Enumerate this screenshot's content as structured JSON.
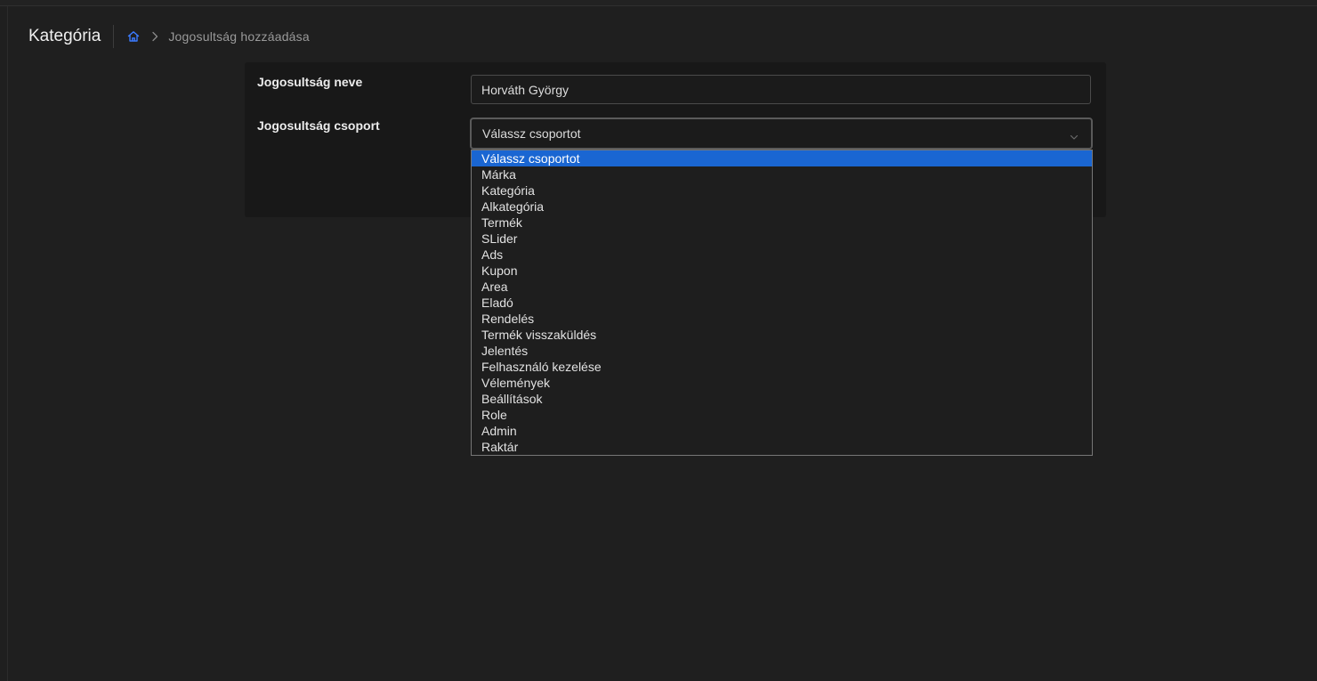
{
  "header": {
    "title": "Kategória",
    "breadcrumb_current": "Jogosultság hozzáadása"
  },
  "form": {
    "name_label": "Jogosultság neve",
    "name_value": "Horváth György",
    "group_label": "Jogosultság csoport",
    "group_selected": "Válassz csoportot"
  },
  "dropdown": {
    "options": [
      "Válassz csoportot",
      "Márka",
      "Kategória",
      "Alkategória",
      "Termék",
      "SLider",
      "Ads",
      "Kupon",
      "Area",
      "Eladó",
      "Rendelés",
      "Termék visszaküldés",
      "Jelentés",
      "Felhasználó kezelése",
      "Vélemények",
      "Beállítások",
      "Role",
      "Admin",
      "Raktár"
    ],
    "highlighted_index": 0
  },
  "colors": {
    "accent": "#1a66d2",
    "home_icon": "#3b7bff",
    "background": "#1f1f1f"
  },
  "icons": {
    "home": "home-icon",
    "breadcrumb_separator": "chevron-right-icon",
    "select_arrow": "chevron-down-icon"
  }
}
